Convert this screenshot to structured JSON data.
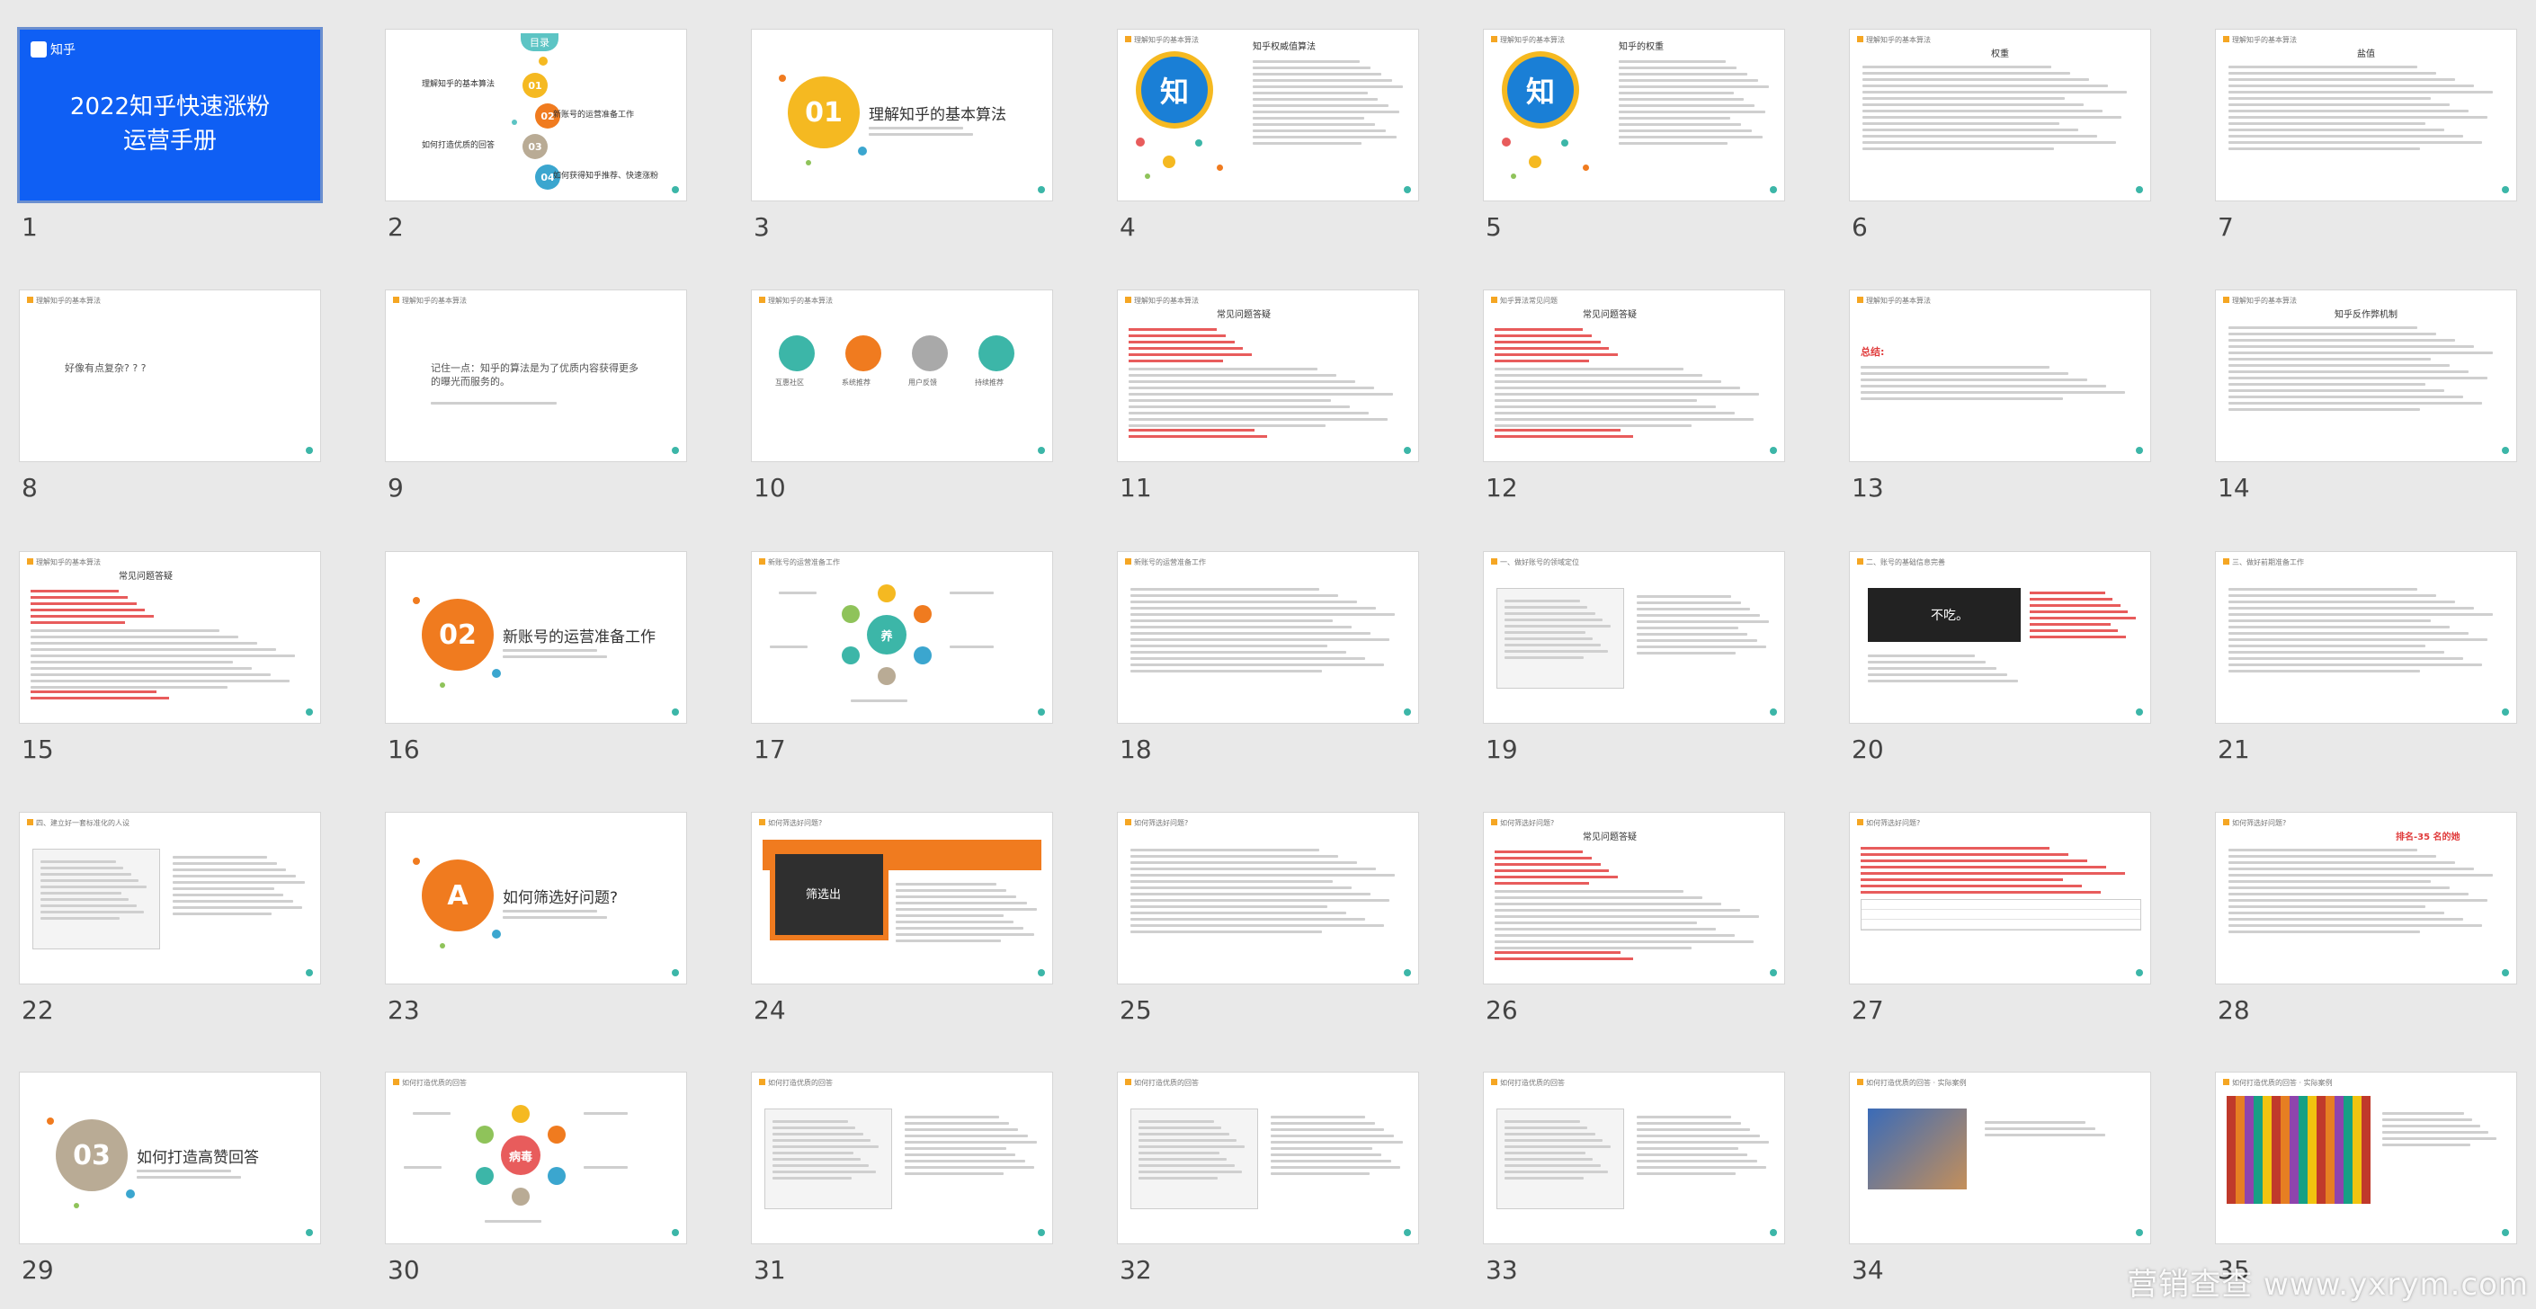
{
  "watermark": "营销查查 www.yxrym.com",
  "slides": [
    {
      "num": "1",
      "kind": "cover",
      "title": "2022知乎快速涨粉运营手册",
      "logo": "知乎"
    },
    {
      "num": "2",
      "kind": "toc",
      "title": "目录",
      "items": [
        "理解知乎的基本算法",
        "新账号的运营准备工作",
        "如何打造优质的回答",
        "如何获得知乎推荐、快速涨粉"
      ]
    },
    {
      "num": "3",
      "kind": "section",
      "badge": "01",
      "title": "理解知乎的基本算法",
      "color": "#f5b921"
    },
    {
      "num": "4",
      "kind": "zhi",
      "head": "理解知乎的基本算法",
      "title": "知乎权威值算法",
      "glyph": "知"
    },
    {
      "num": "5",
      "kind": "zhi",
      "head": "理解知乎的基本算法",
      "title": "知乎的权重",
      "glyph": "知"
    },
    {
      "num": "6",
      "kind": "text",
      "head": "理解知乎的基本算法",
      "title": "权重"
    },
    {
      "num": "7",
      "kind": "text",
      "head": "理解知乎的基本算法",
      "title": "盐值"
    },
    {
      "num": "8",
      "kind": "question",
      "head": "理解知乎的基本算法",
      "title": "好像有点复杂? ? ?"
    },
    {
      "num": "9",
      "kind": "question",
      "head": "理解知乎的基本算法",
      "title": "记住一点：知乎的算法是为了优质内容获得更多的曝光而服务的。"
    },
    {
      "num": "10",
      "kind": "flow",
      "head": "理解知乎的基本算法",
      "labels": [
        "互惠社区",
        "系统推荐",
        "用户反馈",
        "持续推荐"
      ]
    },
    {
      "num": "11",
      "kind": "faq",
      "head": "理解知乎的基本算法",
      "title": "常见问题答疑"
    },
    {
      "num": "12",
      "kind": "faq",
      "head": "知乎算法常见问题",
      "title": "常见问题答疑"
    },
    {
      "num": "13",
      "kind": "summary",
      "head": "理解知乎的基本算法",
      "title": "总结:"
    },
    {
      "num": "14",
      "kind": "text",
      "head": "理解知乎的基本算法",
      "title": "知乎反作弊机制"
    },
    {
      "num": "15",
      "kind": "faq",
      "head": "理解知乎的基本算法",
      "title": "常见问题答疑"
    },
    {
      "num": "16",
      "kind": "section",
      "badge": "02",
      "title": "新账号的运营准备工作",
      "color": "#f07b1f"
    },
    {
      "num": "17",
      "kind": "cycle",
      "head": "新账号的运营准备工作",
      "center": "养"
    },
    {
      "num": "18",
      "kind": "text",
      "head": "新账号的运营准备工作",
      "title": ""
    },
    {
      "num": "19",
      "kind": "text",
      "head": "一、做好账号的领域定位",
      "title": ""
    },
    {
      "num": "20",
      "kind": "image",
      "head": "二、账号的基础信息完善",
      "title": "不吃。"
    },
    {
      "num": "21",
      "kind": "text",
      "head": "三、做好前期准备工作",
      "title": ""
    },
    {
      "num": "22",
      "kind": "text",
      "head": "四、建立好一套标准化的人设",
      "title": ""
    },
    {
      "num": "23",
      "kind": "section",
      "badge": "A",
      "title": "如何筛选好问题?",
      "color": "#f07b1f"
    },
    {
      "num": "24",
      "kind": "screen",
      "head": "如何筛选好问题?",
      "title": "筛选出"
    },
    {
      "num": "25",
      "kind": "text",
      "head": "如何筛选好问题?",
      "title": ""
    },
    {
      "num": "26",
      "kind": "faq",
      "head": "如何筛选好问题?",
      "title": "常见问题答疑"
    },
    {
      "num": "27",
      "kind": "text",
      "head": "如何筛选好问题?",
      "title": ""
    },
    {
      "num": "28",
      "kind": "text",
      "head": "如何筛选好问题?",
      "title": "排名-35 名的她"
    },
    {
      "num": "29",
      "kind": "section",
      "badge": "03",
      "title": "如何打造高赞回答",
      "color": "#b9ab95"
    },
    {
      "num": "30",
      "kind": "cycle",
      "head": "如何打造优质的回答",
      "center": "病毒"
    },
    {
      "num": "31",
      "kind": "text",
      "head": "如何打造优质的回答",
      "title": ""
    },
    {
      "num": "32",
      "kind": "text",
      "head": "如何打造优质的回答",
      "title": ""
    },
    {
      "num": "33",
      "kind": "text",
      "head": "如何打造优质的回答",
      "title": ""
    },
    {
      "num": "34",
      "kind": "image",
      "head": "如何打造优质的回答 · 实际案例",
      "title": ""
    },
    {
      "num": "35",
      "kind": "image",
      "head": "如何打造优质的回答 · 实际案例",
      "title": ""
    }
  ]
}
